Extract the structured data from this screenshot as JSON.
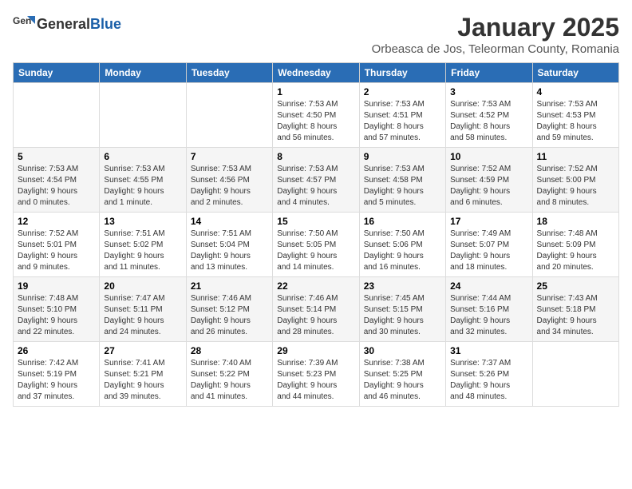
{
  "header": {
    "logo_general": "General",
    "logo_blue": "Blue",
    "month_year": "January 2025",
    "location": "Orbeasca de Jos, Teleorman County, Romania"
  },
  "weekdays": [
    "Sunday",
    "Monday",
    "Tuesday",
    "Wednesday",
    "Thursday",
    "Friday",
    "Saturday"
  ],
  "weeks": [
    [
      {
        "day": "",
        "info": ""
      },
      {
        "day": "",
        "info": ""
      },
      {
        "day": "",
        "info": ""
      },
      {
        "day": "1",
        "info": "Sunrise: 7:53 AM\nSunset: 4:50 PM\nDaylight: 8 hours\nand 56 minutes."
      },
      {
        "day": "2",
        "info": "Sunrise: 7:53 AM\nSunset: 4:51 PM\nDaylight: 8 hours\nand 57 minutes."
      },
      {
        "day": "3",
        "info": "Sunrise: 7:53 AM\nSunset: 4:52 PM\nDaylight: 8 hours\nand 58 minutes."
      },
      {
        "day": "4",
        "info": "Sunrise: 7:53 AM\nSunset: 4:53 PM\nDaylight: 8 hours\nand 59 minutes."
      }
    ],
    [
      {
        "day": "5",
        "info": "Sunrise: 7:53 AM\nSunset: 4:54 PM\nDaylight: 9 hours\nand 0 minutes."
      },
      {
        "day": "6",
        "info": "Sunrise: 7:53 AM\nSunset: 4:55 PM\nDaylight: 9 hours\nand 1 minute."
      },
      {
        "day": "7",
        "info": "Sunrise: 7:53 AM\nSunset: 4:56 PM\nDaylight: 9 hours\nand 2 minutes."
      },
      {
        "day": "8",
        "info": "Sunrise: 7:53 AM\nSunset: 4:57 PM\nDaylight: 9 hours\nand 4 minutes."
      },
      {
        "day": "9",
        "info": "Sunrise: 7:53 AM\nSunset: 4:58 PM\nDaylight: 9 hours\nand 5 minutes."
      },
      {
        "day": "10",
        "info": "Sunrise: 7:52 AM\nSunset: 4:59 PM\nDaylight: 9 hours\nand 6 minutes."
      },
      {
        "day": "11",
        "info": "Sunrise: 7:52 AM\nSunset: 5:00 PM\nDaylight: 9 hours\nand 8 minutes."
      }
    ],
    [
      {
        "day": "12",
        "info": "Sunrise: 7:52 AM\nSunset: 5:01 PM\nDaylight: 9 hours\nand 9 minutes."
      },
      {
        "day": "13",
        "info": "Sunrise: 7:51 AM\nSunset: 5:02 PM\nDaylight: 9 hours\nand 11 minutes."
      },
      {
        "day": "14",
        "info": "Sunrise: 7:51 AM\nSunset: 5:04 PM\nDaylight: 9 hours\nand 13 minutes."
      },
      {
        "day": "15",
        "info": "Sunrise: 7:50 AM\nSunset: 5:05 PM\nDaylight: 9 hours\nand 14 minutes."
      },
      {
        "day": "16",
        "info": "Sunrise: 7:50 AM\nSunset: 5:06 PM\nDaylight: 9 hours\nand 16 minutes."
      },
      {
        "day": "17",
        "info": "Sunrise: 7:49 AM\nSunset: 5:07 PM\nDaylight: 9 hours\nand 18 minutes."
      },
      {
        "day": "18",
        "info": "Sunrise: 7:48 AM\nSunset: 5:09 PM\nDaylight: 9 hours\nand 20 minutes."
      }
    ],
    [
      {
        "day": "19",
        "info": "Sunrise: 7:48 AM\nSunset: 5:10 PM\nDaylight: 9 hours\nand 22 minutes."
      },
      {
        "day": "20",
        "info": "Sunrise: 7:47 AM\nSunset: 5:11 PM\nDaylight: 9 hours\nand 24 minutes."
      },
      {
        "day": "21",
        "info": "Sunrise: 7:46 AM\nSunset: 5:12 PM\nDaylight: 9 hours\nand 26 minutes."
      },
      {
        "day": "22",
        "info": "Sunrise: 7:46 AM\nSunset: 5:14 PM\nDaylight: 9 hours\nand 28 minutes."
      },
      {
        "day": "23",
        "info": "Sunrise: 7:45 AM\nSunset: 5:15 PM\nDaylight: 9 hours\nand 30 minutes."
      },
      {
        "day": "24",
        "info": "Sunrise: 7:44 AM\nSunset: 5:16 PM\nDaylight: 9 hours\nand 32 minutes."
      },
      {
        "day": "25",
        "info": "Sunrise: 7:43 AM\nSunset: 5:18 PM\nDaylight: 9 hours\nand 34 minutes."
      }
    ],
    [
      {
        "day": "26",
        "info": "Sunrise: 7:42 AM\nSunset: 5:19 PM\nDaylight: 9 hours\nand 37 minutes."
      },
      {
        "day": "27",
        "info": "Sunrise: 7:41 AM\nSunset: 5:21 PM\nDaylight: 9 hours\nand 39 minutes."
      },
      {
        "day": "28",
        "info": "Sunrise: 7:40 AM\nSunset: 5:22 PM\nDaylight: 9 hours\nand 41 minutes."
      },
      {
        "day": "29",
        "info": "Sunrise: 7:39 AM\nSunset: 5:23 PM\nDaylight: 9 hours\nand 44 minutes."
      },
      {
        "day": "30",
        "info": "Sunrise: 7:38 AM\nSunset: 5:25 PM\nDaylight: 9 hours\nand 46 minutes."
      },
      {
        "day": "31",
        "info": "Sunrise: 7:37 AM\nSunset: 5:26 PM\nDaylight: 9 hours\nand 48 minutes."
      },
      {
        "day": "",
        "info": ""
      }
    ]
  ]
}
